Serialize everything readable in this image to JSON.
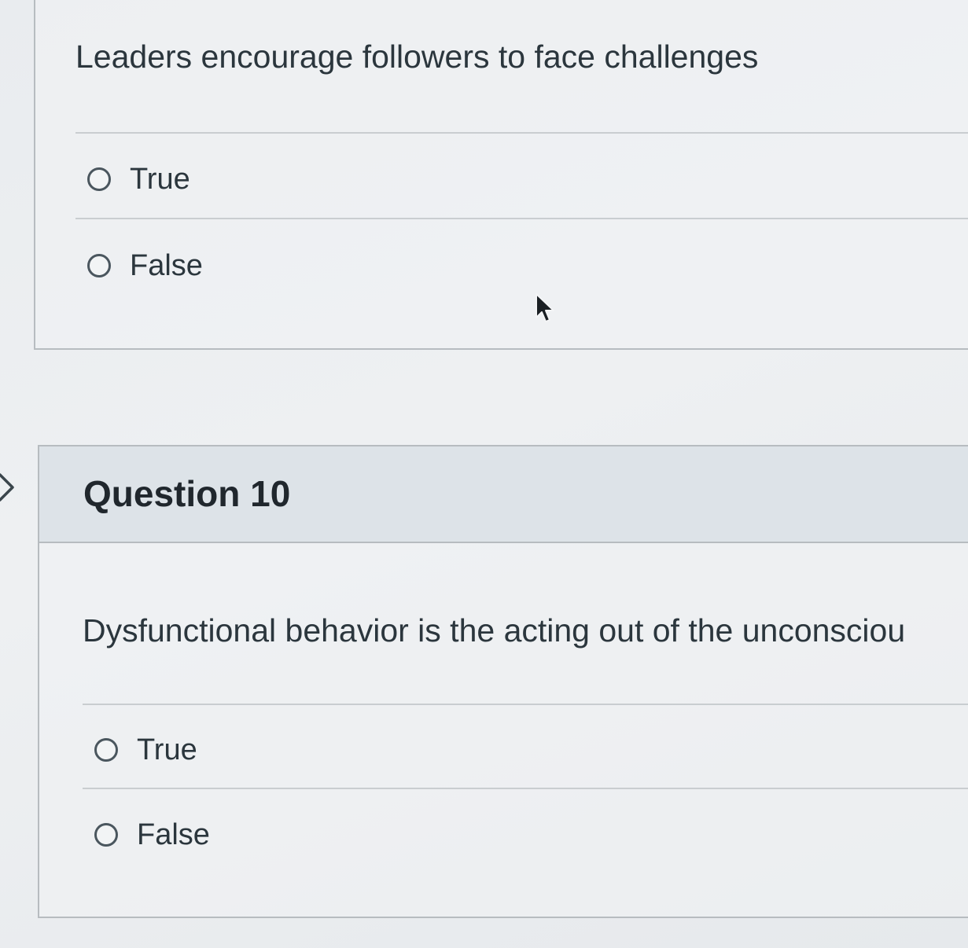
{
  "question9": {
    "prompt": "Leaders encourage followers to face challenges",
    "options": [
      {
        "label": "True",
        "selected": false
      },
      {
        "label": "False",
        "selected": false
      }
    ]
  },
  "question10": {
    "title": "Question 10",
    "prompt": "Dysfunctional behavior is the acting out of the unconsciou",
    "options": [
      {
        "label": "True",
        "selected": false
      },
      {
        "label": "False",
        "selected": false
      }
    ]
  },
  "icons": {
    "collapse": "chevron-right-icon",
    "cursor": "mouse-pointer-icon"
  },
  "colors": {
    "text": "#2b363d",
    "header_bg": "#dde3e8",
    "border": "#b7bcc0"
  }
}
